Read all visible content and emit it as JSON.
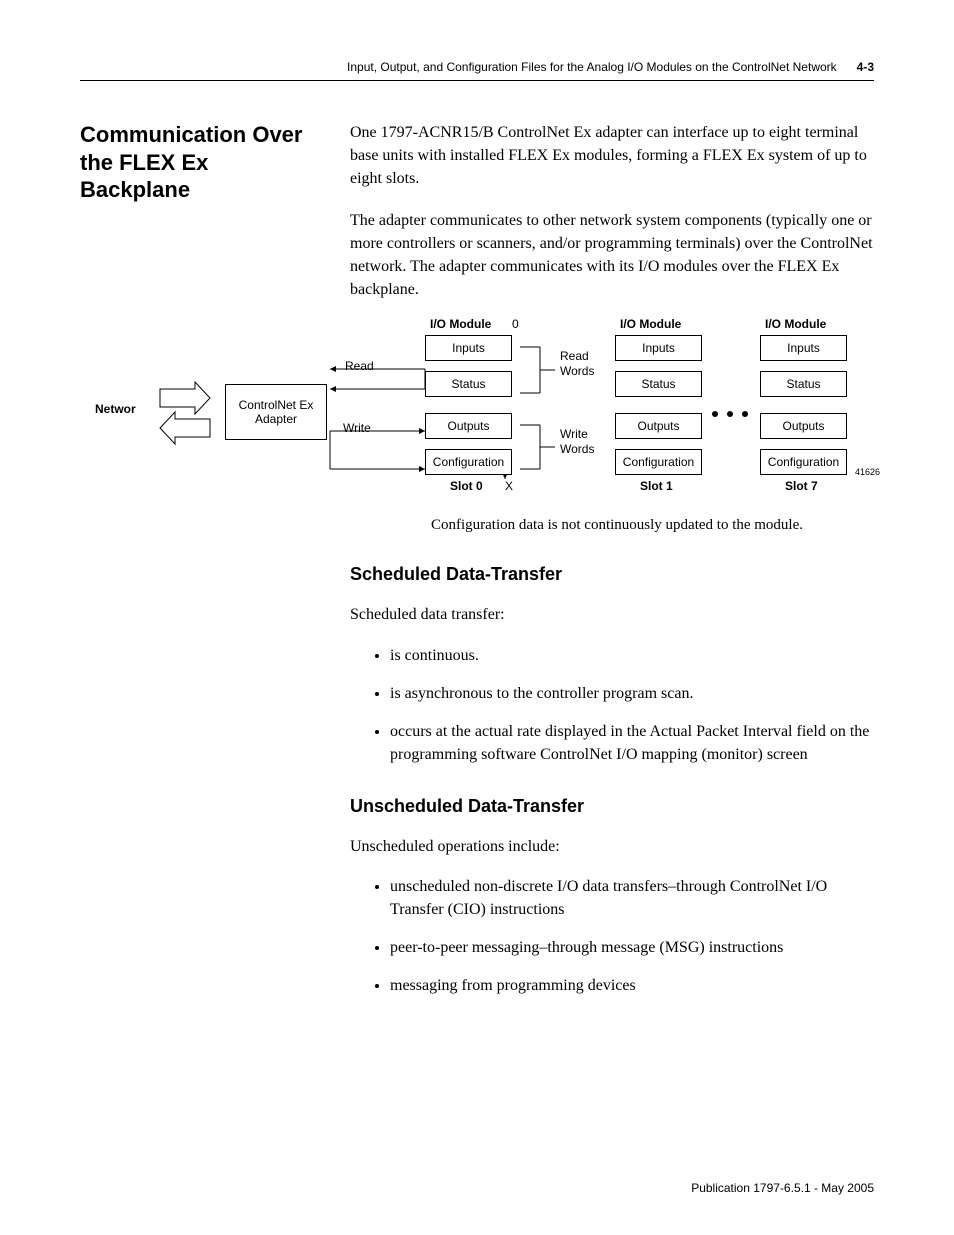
{
  "header": {
    "chapter_title": "Input, Output, and Configuration Files for the Analog I/O Modules on the ControlNet Network",
    "page_number": "4-3"
  },
  "section": {
    "title": "Communication Over the FLEX Ex Backplane",
    "para1": "One 1797-ACNR15/B ControlNet Ex adapter can interface up to eight terminal base units with installed FLEX Ex modules, forming a FLEX Ex system of up to eight slots.",
    "para2": "The adapter communicates to other network system components (typically one or more controllers or scanners, and/or programming terminals) over the ControlNet network. The adapter communicates with its I/O modules over the FLEX Ex backplane."
  },
  "diagram": {
    "network_label": "Networ",
    "adapter_label": "ControlNet Ex Adapter",
    "read_label": "Read",
    "write_label": "Write",
    "zero_label": "0",
    "read_words": "Read Words",
    "write_words": "Write Words",
    "x_label": "X",
    "modules": [
      {
        "title": "I/O Module",
        "cells": [
          "Inputs",
          "Status",
          "Outputs",
          "Configuration"
        ],
        "slot": "Slot 0"
      },
      {
        "title": "I/O Module",
        "cells": [
          "Inputs",
          "Status",
          "Outputs",
          "Configuration"
        ],
        "slot": "Slot 1"
      },
      {
        "title": "I/O Module",
        "cells": [
          "Inputs",
          "Status",
          "Outputs",
          "Configuration"
        ],
        "slot": "Slot 7"
      }
    ],
    "fig_id": "41626"
  },
  "caption": "Configuration data is not continuously updated to the module.",
  "scheduled": {
    "title": "Scheduled Data-Transfer",
    "intro": "Scheduled data transfer:",
    "bullets": [
      "is continuous.",
      "is asynchronous to the controller program scan.",
      "occurs at the actual rate displayed in the Actual Packet Interval field on the programming software ControlNet I/O mapping (monitor) screen"
    ]
  },
  "unscheduled": {
    "title": "Unscheduled Data-Transfer",
    "intro": "Unscheduled operations include:",
    "bullets": [
      "unscheduled non-discrete I/O data transfers–through ControlNet I/O Transfer (CIO) instructions",
      "peer-to-peer messaging–through message (MSG) instructions",
      "messaging from programming devices"
    ]
  },
  "footer": "Publication 1797-6.5.1 - May 2005"
}
